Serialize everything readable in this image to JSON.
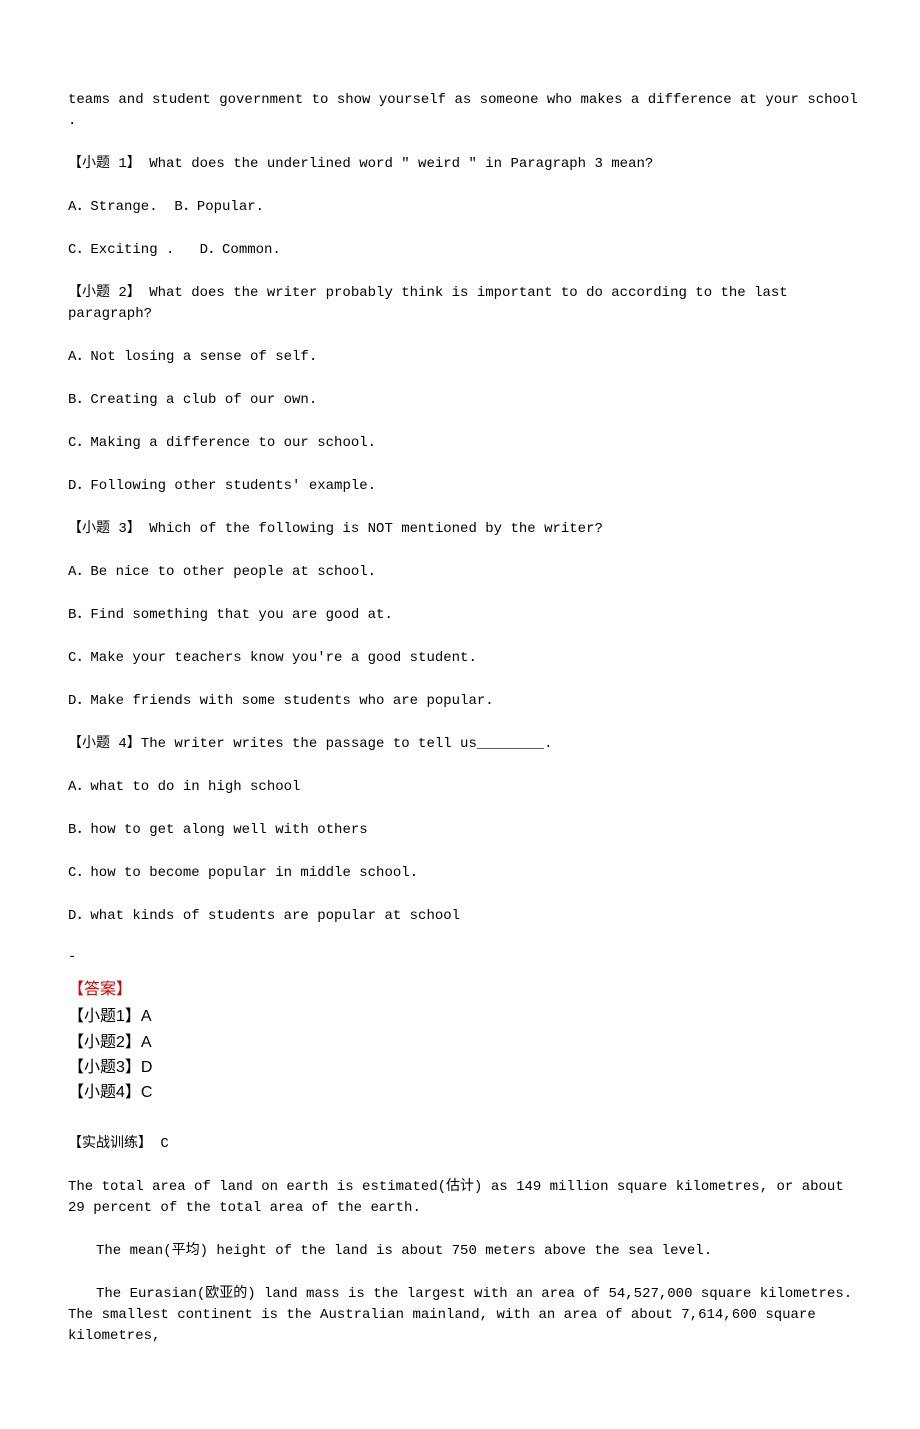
{
  "intro": "teams and student government to show yourself as someone who makes a difference at your school .",
  "q1": {
    "stem": "【小题 1】 What does the underlined word \" weird \" in Paragraph 3 mean?",
    "ab": "A．Strange.  B．Popular.",
    "cd": "C．Exciting .   D．Common."
  },
  "q2": {
    "stem": "【小题 2】 What does the writer probably think is important to do according to the last paragraph?",
    "a": "A．Not losing a sense of self.",
    "b": "B．Creating a club of our own.",
    "c": "C．Making a difference to our school.",
    "d": "D．Following other students' example."
  },
  "q3": {
    "stem": "【小题 3】 Which of the following is NOT mentioned by the writer?",
    "a": "A．Be nice to other people at school.",
    "b": "B．Find something that you are good at.",
    "c": "C．Make your teachers know you're a good student.",
    "d": "D．Make friends with some students who are popular."
  },
  "q4": {
    "stem": "【小题 4】The writer writes the passage to tell us________.",
    "a": "A．what to do in high school",
    "b": "B．how to get along well with others",
    "c": "C．how to become popular in middle school.",
    "d": "D．what kinds of students are popular at school"
  },
  "dash": "-",
  "answer": {
    "title": "【答案】",
    "a1": "【小题1】A",
    "a2": "【小题2】A",
    "a3": "【小题3】D",
    "a4": "【小题4】C"
  },
  "sectionC": {
    "title": "【实战训练】 C",
    "p1": "The total area of land on earth is estimated(估计) as 149 million square kilometres, or about 29 percent of the total area of the earth.",
    "p2": "The mean(平均) height of the land is about 750 meters above the sea level.",
    "p3": "The Eurasian(欧亚的) land mass is the largest with an area of 54,527,000 square kilometres. The smallest continent is the Australian mainland, with an area of about 7,614,600 square kilometres,"
  }
}
